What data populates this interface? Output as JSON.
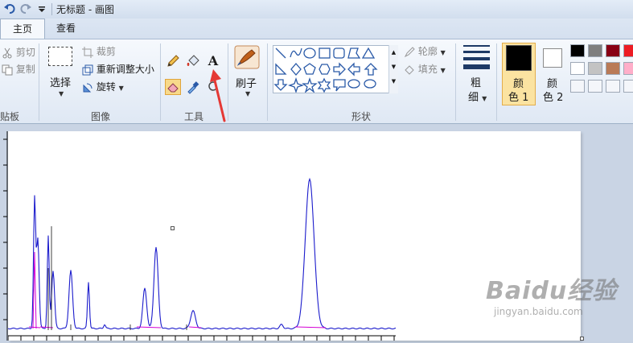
{
  "window": {
    "title": "无标题 - 画图"
  },
  "tabs": [
    {
      "label": "主页",
      "active": true
    },
    {
      "label": "查看",
      "active": false
    }
  ],
  "clipboard": {
    "cut_label": "剪切",
    "copy_label": "复制",
    "group_label": "贴板"
  },
  "image": {
    "select_label": "选择",
    "crop_label": "裁剪",
    "resize_label": "重新调整大小",
    "rotate_label": "旋转",
    "group_label": "图像"
  },
  "tools": {
    "group_label": "工具",
    "text_tool_glyph": "A"
  },
  "brushes": {
    "label": "刷子"
  },
  "shapes": {
    "group_label": "形状",
    "outline_label": "轮廓",
    "fill_label": "填充"
  },
  "size": {
    "label_line1": "粗",
    "label_line2": "细"
  },
  "colors": {
    "color1_line1": "颜",
    "color1_line2": "色 1",
    "color2_line1": "颜",
    "color2_line2": "色 2",
    "color1_value": "#000000",
    "color2_value": "#ffffff",
    "palette_row1": [
      "#000000",
      "#7f7f7f",
      "#880015",
      "#ed1c24"
    ],
    "palette_row2": [
      "#ffffff",
      "#c3c3c3",
      "#b97a57",
      "#ffaec9"
    ]
  },
  "canvas": {
    "chromatogram_trace_color": "#1c1ccc",
    "baseline_color": "#d400d4",
    "axis_color": "#000000"
  },
  "watermark": {
    "brand": "Baidu经验",
    "url": "jingyan.baidu.com"
  },
  "annotation": {
    "arrow_color": "#e53935"
  }
}
